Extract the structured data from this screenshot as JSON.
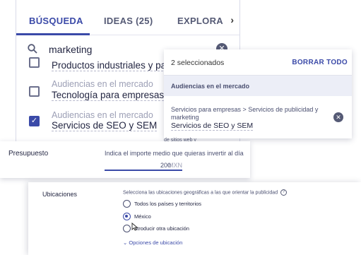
{
  "tabs": {
    "search": "BÚSQUEDA",
    "ideas": "IDEAS (25)",
    "explore": "EXPLORA",
    "next_icon": "chevron-right-icon"
  },
  "search": {
    "value": "marketing",
    "icon": "search-icon",
    "clear_icon": "close-icon"
  },
  "options": [
    {
      "name": "Productos industriales y para en",
      "category": "",
      "checked": false
    },
    {
      "category": "Audiencias en el mercado",
      "name": "Tecnología para empresas",
      "checked": false
    },
    {
      "category": "Audiencias en el mercado",
      "name": "Servicios de SEO y SEM",
      "checked": true
    }
  ],
  "selected": {
    "count_label": "2 seleccionados",
    "clear_all": "BORRAR TODO",
    "group": "Audiencias en el mercado",
    "item_path": "Servicios para empresas > Servicios de publicidad y marketing",
    "item_name": "Servicios de SEO y SEM",
    "fragment": "de sitios web y"
  },
  "budget": {
    "title": "Presupuesto",
    "hint": "Indica el importe medio que quieras invertir al día",
    "value": "200",
    "unit": "MXN"
  },
  "locations": {
    "title": "Ubicaciones",
    "hint": "Selecciona las ubicaciones geográficas a las que orientar la publicidad",
    "options": [
      {
        "label": "Todos los países y territorios",
        "selected": false
      },
      {
        "label": "México",
        "selected": true
      },
      {
        "label": "ntroducir otra ubicación",
        "selected": false
      }
    ],
    "more": "Opciones de ubicación"
  },
  "colors": {
    "accent": "#3b4aa8",
    "text": "#232642",
    "muted": "#9da0b6"
  }
}
